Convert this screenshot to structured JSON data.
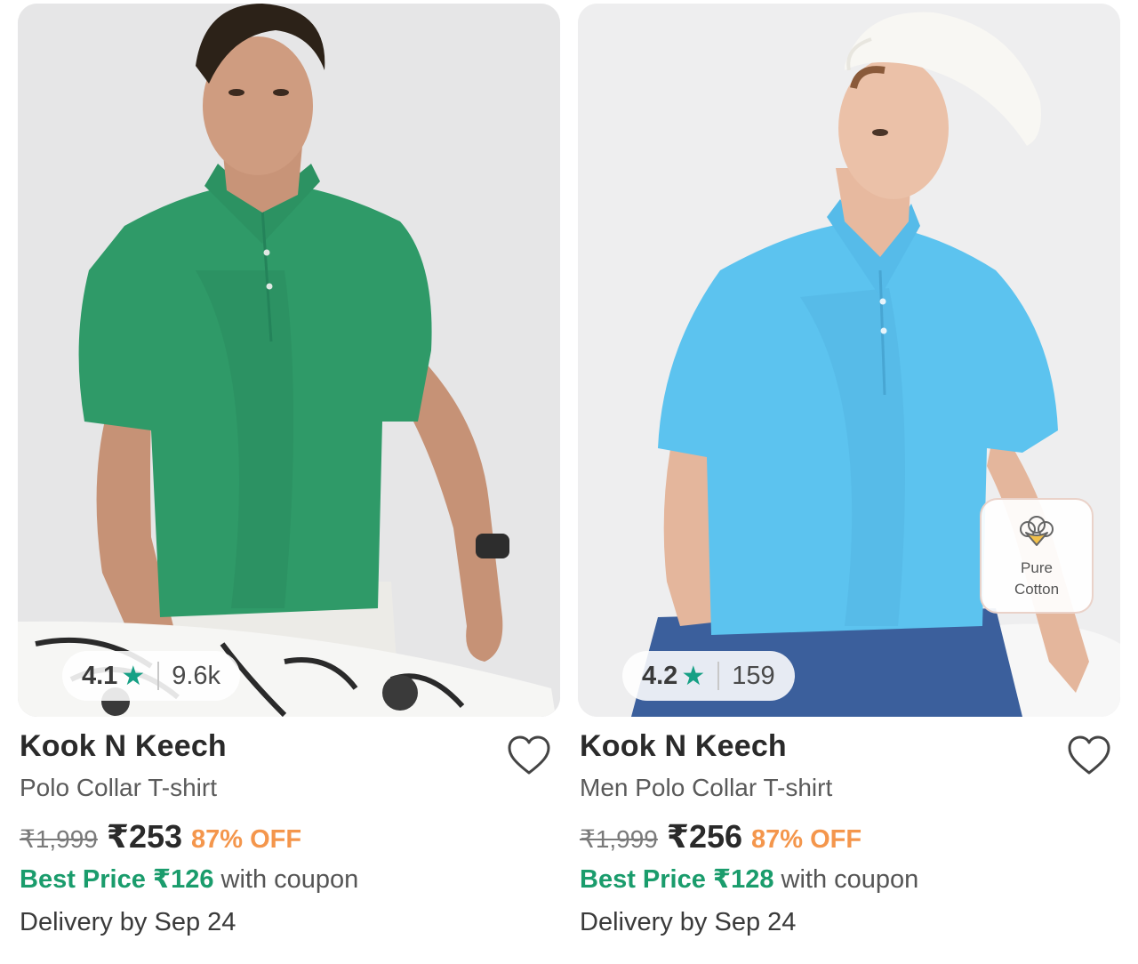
{
  "colors": {
    "star": "#16a085",
    "best_price": "#1a9c6c",
    "discount": "#f4964c",
    "shirt_left": "#2f9a68",
    "shirt_right": "#5cc3ef"
  },
  "products": [
    {
      "rating": "4.1",
      "rating_icon": "star-icon",
      "rating_count": "9.6k",
      "brand": "Kook N Keech",
      "name": "Polo Collar T-shirt",
      "mrp": "₹1,999",
      "price": "₹253",
      "discount": "87% OFF",
      "best_price_label": "Best Price ₹126",
      "best_price_suffix": " with coupon",
      "delivery": "Delivery by Sep 24",
      "wishlist_icon": "heart-icon"
    },
    {
      "rating": "4.2",
      "rating_icon": "star-icon",
      "rating_count": "159",
      "brand": "Kook N Keech",
      "name": "Men Polo Collar T-shirt",
      "mrp": "₹1,999",
      "price": "₹256",
      "discount": "87% OFF",
      "best_price_label": "Best Price ₹128",
      "best_price_suffix": " with coupon",
      "delivery": "Delivery by Sep 24",
      "wishlist_icon": "heart-icon",
      "badge": {
        "icon": "cotton-flower-icon",
        "line1": "Pure",
        "line2": "Cotton"
      }
    }
  ]
}
